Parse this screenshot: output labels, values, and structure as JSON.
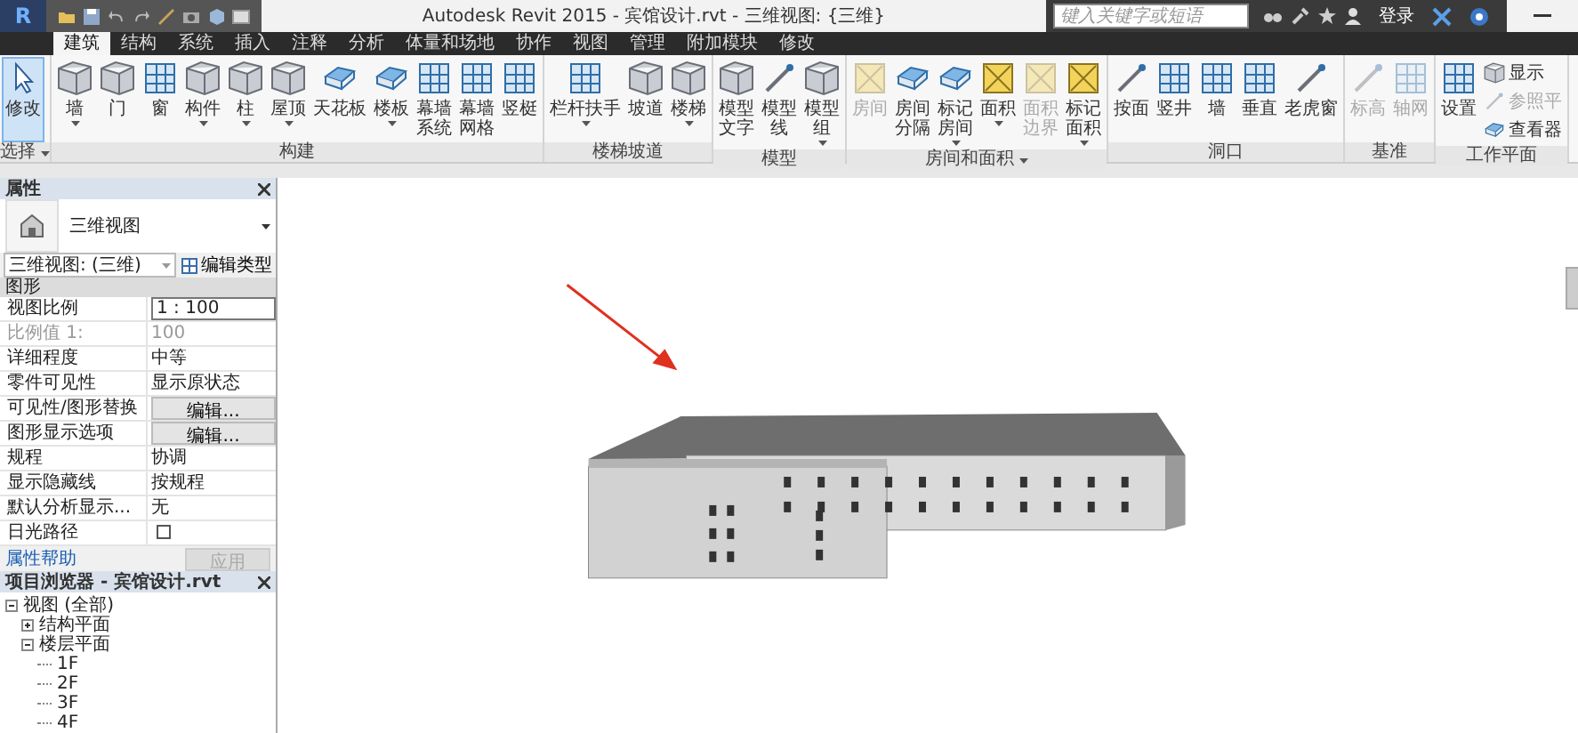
{
  "title_bar": {
    "app_button": "R",
    "title": "Autodesk Revit 2015 -   宾馆设计.rvt - 三维视图: {三维}",
    "search": {
      "placeholder": "键入关键字或短语"
    },
    "sign_in": "登录"
  },
  "tabs": [
    {
      "label": "建筑",
      "selected": true
    },
    {
      "label": "结构",
      "selected": false
    },
    {
      "label": "系统",
      "selected": false
    },
    {
      "label": "插入",
      "selected": false
    },
    {
      "label": "注释",
      "selected": false
    },
    {
      "label": "分析",
      "selected": false
    },
    {
      "label": "体量和场地",
      "selected": false
    },
    {
      "label": "协作",
      "selected": false
    },
    {
      "label": "视图",
      "selected": false
    },
    {
      "label": "管理",
      "selected": false
    },
    {
      "label": "附加模块",
      "selected": false
    },
    {
      "label": "修改",
      "selected": false
    }
  ],
  "ribbon": {
    "panels": [
      {
        "title": "选择",
        "dropdown": true,
        "tools": [
          {
            "label": "修改",
            "selected": true,
            "disabled": false,
            "dropdown": false
          }
        ]
      },
      {
        "title": "构建",
        "dropdown": false,
        "tools": [
          {
            "label": "墙",
            "selected": false,
            "disabled": false,
            "dropdown": true
          },
          {
            "label": "门",
            "selected": false,
            "disabled": false,
            "dropdown": false
          },
          {
            "label": "窗",
            "selected": false,
            "disabled": false,
            "dropdown": false
          },
          {
            "label": "构件",
            "selected": false,
            "disabled": false,
            "dropdown": true
          },
          {
            "label": "柱",
            "selected": false,
            "disabled": false,
            "dropdown": true
          },
          {
            "label": "屋顶",
            "selected": false,
            "disabled": false,
            "dropdown": true
          },
          {
            "label": "天花板",
            "selected": false,
            "disabled": false,
            "dropdown": false
          },
          {
            "label": "楼板",
            "selected": false,
            "disabled": false,
            "dropdown": true
          },
          {
            "label": "幕墙系统",
            "selected": false,
            "disabled": false,
            "dropdown": false
          },
          {
            "label": "幕墙网格",
            "selected": false,
            "disabled": false,
            "dropdown": false
          },
          {
            "label": "竖梃",
            "selected": false,
            "disabled": false,
            "dropdown": false
          }
        ]
      },
      {
        "title": "楼梯坡道",
        "dropdown": false,
        "tools": [
          {
            "label": "栏杆扶手",
            "selected": false,
            "disabled": false,
            "dropdown": true
          },
          {
            "label": "坡道",
            "selected": false,
            "disabled": false,
            "dropdown": false
          },
          {
            "label": "楼梯",
            "selected": false,
            "disabled": false,
            "dropdown": true
          }
        ]
      },
      {
        "title": "模型",
        "dropdown": false,
        "tools": [
          {
            "label": "模型文字",
            "selected": false,
            "disabled": false,
            "dropdown": false
          },
          {
            "label": "模型线",
            "selected": false,
            "disabled": false,
            "dropdown": false
          },
          {
            "label": "模型组",
            "selected": false,
            "disabled": false,
            "dropdown": true
          }
        ]
      },
      {
        "title": "房间和面积",
        "dropdown": true,
        "tools": [
          {
            "label": "房间",
            "selected": false,
            "disabled": true,
            "dropdown": false
          },
          {
            "label": "房间分隔",
            "selected": false,
            "disabled": false,
            "dropdown": false
          },
          {
            "label": "标记房间",
            "selected": false,
            "disabled": false,
            "dropdown": true
          },
          {
            "label": "面积",
            "selected": false,
            "disabled": false,
            "dropdown": true
          },
          {
            "label": "面积边界",
            "selected": false,
            "disabled": true,
            "dropdown": false
          },
          {
            "label": "标记面积",
            "selected": false,
            "disabled": false,
            "dropdown": true
          }
        ]
      },
      {
        "title": "洞口",
        "dropdown": false,
        "tools": [
          {
            "label": "按面",
            "selected": false,
            "disabled": false,
            "dropdown": false
          },
          {
            "label": "竖井",
            "selected": false,
            "disabled": false,
            "dropdown": false
          },
          {
            "label": "墙",
            "selected": false,
            "disabled": false,
            "dropdown": false
          },
          {
            "label": "垂直",
            "selected": false,
            "disabled": false,
            "dropdown": false
          },
          {
            "label": "老虎窗",
            "selected": false,
            "disabled": false,
            "dropdown": false
          }
        ]
      },
      {
        "title": "基准",
        "dropdown": false,
        "tools": [
          {
            "label": "标高",
            "selected": false,
            "disabled": true,
            "dropdown": false
          },
          {
            "label": "轴网",
            "selected": false,
            "disabled": true,
            "dropdown": false
          }
        ]
      },
      {
        "title": "工作平面",
        "dropdown": false,
        "tools": [
          {
            "label": "设置",
            "selected": false,
            "disabled": false,
            "dropdown": false
          },
          {
            "label": "显示",
            "selected": false,
            "disabled": false,
            "dropdown": false
          },
          {
            "label": "参照平",
            "selected": false,
            "disabled": true,
            "dropdown": false
          },
          {
            "label": "查看器",
            "selected": false,
            "disabled": false,
            "dropdown": false
          }
        ]
      }
    ]
  },
  "properties": {
    "title": "属性",
    "type_name": "三维视图",
    "instance_selector": "三维视图: (三维)",
    "edit_type": "编辑类型",
    "section": "图形",
    "rows": [
      {
        "name": "视图比例",
        "value": "1 : 100",
        "kind": "field",
        "disabled": false
      },
      {
        "name": "比例值 1:",
        "value": "100",
        "kind": "text",
        "disabled": true
      },
      {
        "name": "详细程度",
        "value": "中等",
        "kind": "text",
        "disabled": false
      },
      {
        "name": "零件可见性",
        "value": "显示原状态",
        "kind": "text",
        "disabled": false
      },
      {
        "name": "可见性/图形替换",
        "value": "编辑...",
        "kind": "button",
        "disabled": false
      },
      {
        "name": "图形显示选项",
        "value": "编辑...",
        "kind": "button",
        "disabled": false
      },
      {
        "name": "规程",
        "value": "协调",
        "kind": "text",
        "disabled": false
      },
      {
        "name": "显示隐藏线",
        "value": "按规程",
        "kind": "text",
        "disabled": false
      },
      {
        "name": "默认分析显示...",
        "value": "无",
        "kind": "text",
        "disabled": false
      },
      {
        "name": "日光路径",
        "kind": "checkbox",
        "checked": false,
        "disabled": false
      }
    ],
    "help_link": "属性帮助",
    "apply": {
      "label": "应用",
      "disabled": true
    }
  },
  "browser": {
    "title": "项目浏览器 - 宾馆设计.rvt",
    "tree": [
      {
        "label": "视图 (全部)",
        "expanded": true,
        "children": [
          {
            "label": "结构平面",
            "expanded": false
          },
          {
            "label": "楼层平面",
            "expanded": true,
            "children": [
              {
                "label": "1F"
              },
              {
                "label": "2F"
              },
              {
                "label": "3F"
              },
              {
                "label": "4F"
              }
            ]
          }
        ]
      }
    ]
  }
}
